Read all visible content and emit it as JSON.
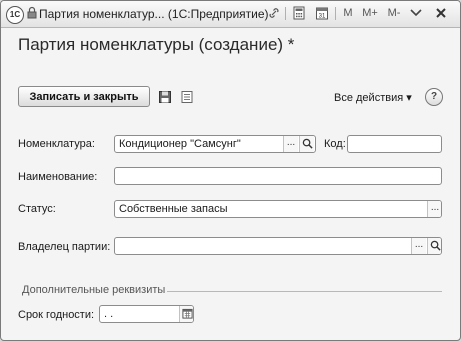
{
  "window": {
    "title": "Партия номенклатур... (1С:Предприятие)",
    "logo": "1С",
    "toolbar": {
      "m": "M",
      "m_plus": "M+",
      "m_minus": "M-"
    }
  },
  "form": {
    "title": "Партия номенклатуры (создание) *",
    "save_close_label": "Записать и закрыть",
    "all_actions_label": "Все действия ▾",
    "help_label": "?"
  },
  "fields": {
    "nomenclature": {
      "label": "Номенклатура:",
      "value": "Кондиционер \"Самсунг\""
    },
    "code": {
      "label": "Код:",
      "value": ""
    },
    "name": {
      "label": "Наименование:",
      "value": ""
    },
    "status": {
      "label": "Статус:",
      "value": "Собственные запасы"
    },
    "owner": {
      "label": "Владелец партии:",
      "value": ""
    },
    "additional": {
      "label": "Дополнительные реквизиты"
    },
    "expiry": {
      "label": "Срок годности:",
      "value": " .  ."
    }
  },
  "icons": {
    "save": "floppy-disk-icon",
    "list": "list-icon",
    "calendar": "calendar-icon",
    "search": "search-icon",
    "ellipsis": "..."
  }
}
